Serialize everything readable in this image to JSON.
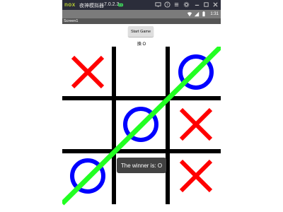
{
  "emulator": {
    "logo": "nox",
    "title": "夜神模拟器",
    "version": "7.0.2.3"
  },
  "status_bar": {
    "time": "1:31"
  },
  "app": {
    "title": "Screen1"
  },
  "game": {
    "start_button": "Start Game",
    "status_text": "換 O",
    "board": [
      [
        "X",
        "",
        "O"
      ],
      [
        "",
        "O",
        "X"
      ],
      [
        "O",
        "",
        "X"
      ]
    ],
    "winning_line": "diagonal from bottom-left to top-right",
    "toast": "The winner is: O"
  },
  "colors": {
    "x_mark": "#ff0000",
    "o_mark": "#0000ff",
    "win_line": "#22ff22",
    "grid": "#000000",
    "emulator_bar": "#2b2d3a",
    "status_bar": "#7b7b7b",
    "action_bar": "#555555"
  }
}
